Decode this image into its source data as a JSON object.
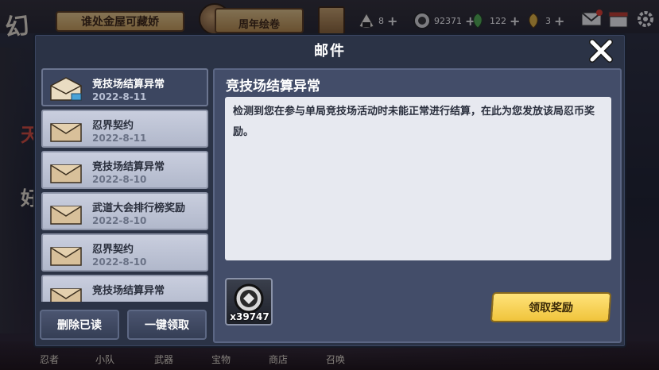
{
  "hud": {
    "banner_left": "谁处金屋可藏娇",
    "banner_mid": "周年绘卷",
    "resources": [
      {
        "icon": "onigiri-icon",
        "value": "8"
      },
      {
        "icon": "coin-icon",
        "value": "92371"
      },
      {
        "icon": "green-gem-icon",
        "value": "122"
      },
      {
        "icon": "gold-gem-icon",
        "value": "3"
      }
    ],
    "logo": "幻"
  },
  "bottom_nav": [
    "忍者",
    "小队",
    "武器",
    "宝物",
    "商店",
    "召唤"
  ],
  "modal": {
    "title": "邮件",
    "mails": [
      {
        "subject": "竞技场结算异常",
        "date": "2022-8-11",
        "selected": true
      },
      {
        "subject": "忍界契约",
        "date": "2022-8-11",
        "selected": false
      },
      {
        "subject": "竞技场结算异常",
        "date": "2022-8-10",
        "selected": false
      },
      {
        "subject": "武道大会排行榜奖励",
        "date": "2022-8-10",
        "selected": false
      },
      {
        "subject": "忍界契约",
        "date": "2022-8-10",
        "selected": false
      },
      {
        "subject": "竞技场结算异常",
        "date": "",
        "selected": false
      }
    ],
    "delete_read_label": "删除已读",
    "claim_all_label": "一键领取",
    "detail": {
      "title": "竞技场结算异常",
      "body": "检测到您在参与单局竞技场活动时未能正常进行结算，在此为您发放该局忍币奖励。",
      "reward_quantity": "x39747",
      "reward_icon": "ninja-coin-icon",
      "claim_label": "领取奖励"
    }
  },
  "colors": {
    "modal_bg": "#2b3346",
    "selected_item": "#3c4660",
    "claim_button": "#f0c43c"
  }
}
